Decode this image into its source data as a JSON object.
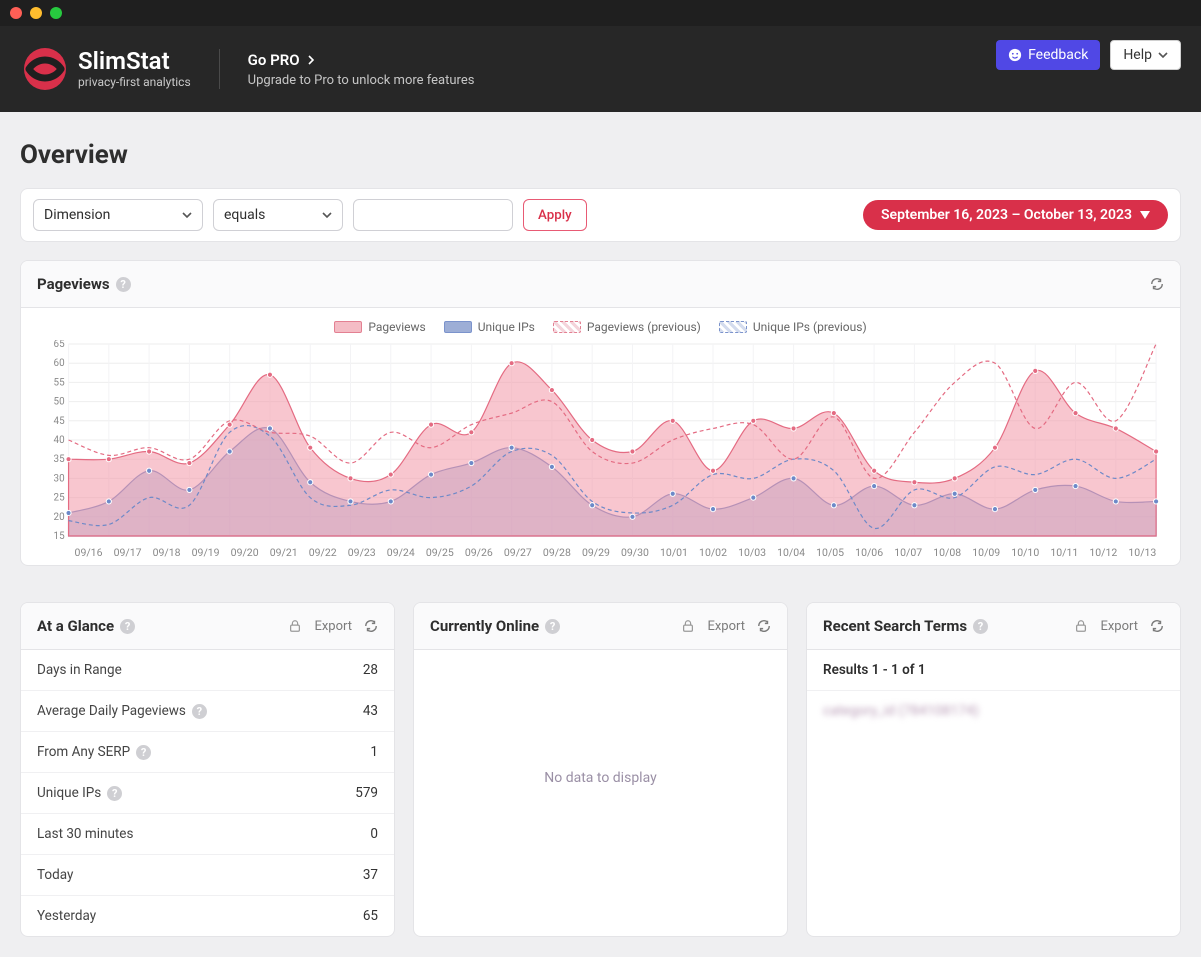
{
  "brand": {
    "name": "SlimStat",
    "tagline": "privacy-first analytics"
  },
  "topbar": {
    "promo_title": "Go PRO",
    "promo_sub": "Upgrade to Pro to unlock more features",
    "feedback_label": "Feedback",
    "help_label": "Help"
  },
  "page": {
    "title": "Overview"
  },
  "filter": {
    "dimension_placeholder": "Dimension",
    "operator_placeholder": "equals",
    "apply_label": "Apply",
    "daterange": "September 16, 2023 – October 13, 2023"
  },
  "chart_card": {
    "title": "Pageviews"
  },
  "chart_data": {
    "type": "area",
    "ylabel": "",
    "ylim": [
      15,
      65
    ],
    "yticks": [
      15,
      20,
      25,
      30,
      35,
      40,
      45,
      50,
      55,
      60,
      65
    ],
    "categories": [
      "09/16",
      "09/17",
      "09/18",
      "09/19",
      "09/20",
      "09/21",
      "09/22",
      "09/23",
      "09/24",
      "09/25",
      "09/26",
      "09/27",
      "09/28",
      "09/29",
      "09/30",
      "10/01",
      "10/02",
      "10/03",
      "10/04",
      "10/05",
      "10/06",
      "10/07",
      "10/08",
      "10/09",
      "10/10",
      "10/11",
      "10/12",
      "10/13"
    ],
    "series": [
      {
        "name": "Pageviews",
        "style": "pv",
        "values": [
          35,
          35,
          37,
          34,
          44,
          57,
          38,
          30,
          31,
          44,
          42,
          60,
          53,
          40,
          37,
          45,
          32,
          45,
          43,
          47,
          32,
          29,
          30,
          38,
          58,
          47,
          43,
          37
        ]
      },
      {
        "name": "Unique IPs",
        "style": "uip",
        "values": [
          21,
          24,
          32,
          27,
          37,
          43,
          29,
          24,
          24,
          31,
          34,
          38,
          33,
          23,
          20,
          26,
          22,
          25,
          30,
          23,
          28,
          23,
          26,
          22,
          27,
          28,
          24,
          24
        ]
      },
      {
        "name": "Pageviews (previous)",
        "style": "pvp",
        "values": [
          40,
          36,
          38,
          35,
          45,
          42,
          41,
          34,
          42,
          38,
          44,
          47,
          50,
          37,
          34,
          40,
          43,
          44,
          35,
          46,
          30,
          42,
          55,
          60,
          43,
          55,
          45,
          65
        ]
      },
      {
        "name": "Unique IPs (previous)",
        "style": "uipp",
        "values": [
          19,
          18,
          25,
          23,
          42,
          41,
          25,
          23,
          27,
          25,
          28,
          37,
          36,
          24,
          21,
          23,
          31,
          30,
          35,
          32,
          17,
          27,
          25,
          33,
          31,
          35,
          30,
          35
        ]
      }
    ]
  },
  "glance": {
    "title": "At a Glance",
    "export_label": "Export",
    "rows": [
      {
        "label": "Days in Range",
        "help": false,
        "value": "28"
      },
      {
        "label": "Average Daily Pageviews",
        "help": true,
        "value": "43"
      },
      {
        "label": "From Any SERP",
        "help": true,
        "value": "1"
      },
      {
        "label": "Unique IPs",
        "help": true,
        "value": "579"
      },
      {
        "label": "Last 30 minutes",
        "help": false,
        "value": "0"
      },
      {
        "label": "Today",
        "help": false,
        "value": "37"
      },
      {
        "label": "Yesterday",
        "help": false,
        "value": "65"
      }
    ]
  },
  "online": {
    "title": "Currently Online",
    "export_label": "Export",
    "empty_text": "No data to display"
  },
  "search": {
    "title": "Recent Search Terms",
    "export_label": "Export",
    "results_text": "Results 1 - 1 of 1",
    "blurred_sample": "category_id (784108174)"
  }
}
